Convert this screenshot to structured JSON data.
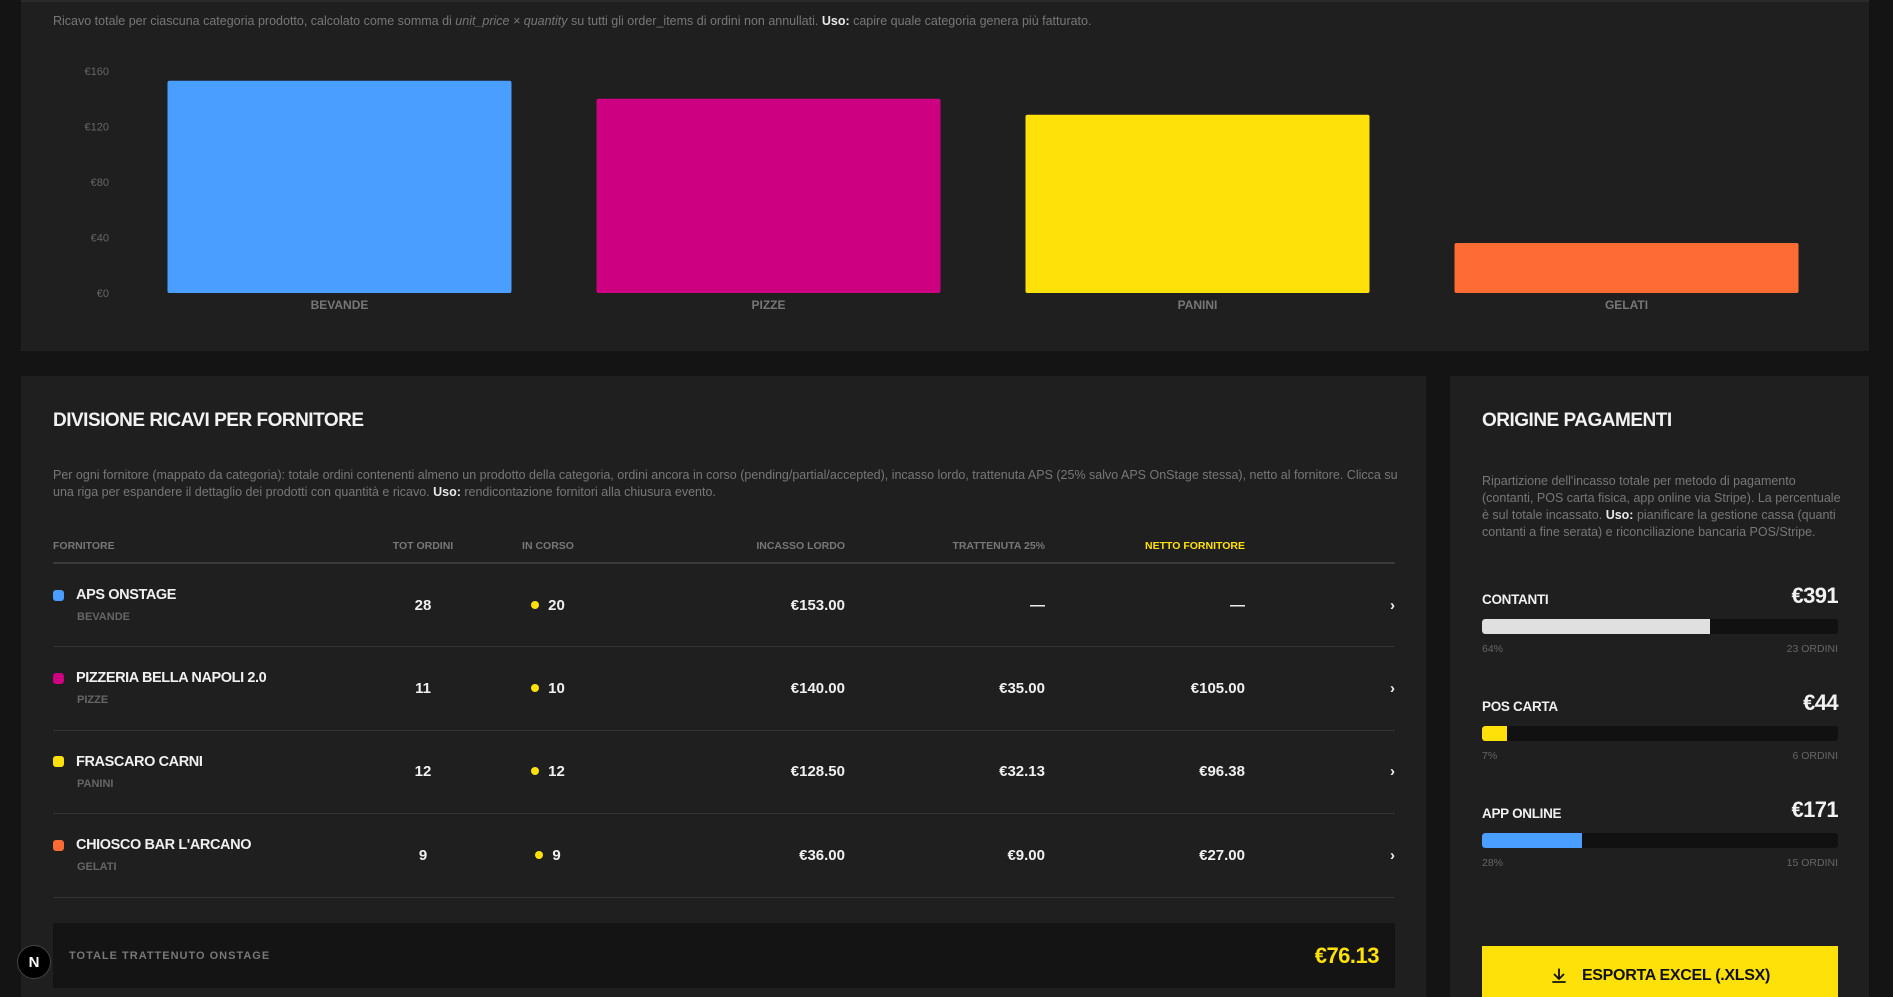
{
  "chart": {
    "description_prefix": "Ricavo totale per ciascuna categoria prodotto, calcolato come somma di ",
    "description_formula": "unit_price × quantity",
    "description_middle": " su tutti gli order_items di ordini non annullati. ",
    "description_use_label": "Uso:",
    "description_use": " capire quale categoria genera più fatturato."
  },
  "chart_data": {
    "type": "bar",
    "categories": [
      "BEVANDE",
      "PIZZE",
      "PANINI",
      "GELATI"
    ],
    "values": [
      153,
      140,
      128.5,
      36
    ],
    "colors": [
      "#4a9eff",
      "#cc0080",
      "#ffe10a",
      "#ff6b35"
    ],
    "ylim": [
      0,
      160
    ],
    "yticks": [
      0,
      40,
      80,
      120,
      160
    ],
    "ytick_labels": [
      "€0",
      "€40",
      "€80",
      "€120",
      "€160"
    ],
    "title": "",
    "xlabel": "",
    "ylabel": "",
    "grid": false,
    "legend": "none"
  },
  "suppliers": {
    "title": "DIVISIONE RICAVI PER FORNITORE",
    "description": "Per ogni fornitore (mappato da categoria): totale ordini contenenti almeno un prodotto della categoria, ordini ancora in corso (pending/partial/accepted), incasso lordo, trattenuta APS (25% salvo APS OnStage stessa), netto al fornitore. Clicca su una riga per espandere il dettaglio dei prodotti con quantità e ricavo. ",
    "description_use_label": "Uso:",
    "description_use": " rendicontazione fornitori alla chiusura evento.",
    "columns": {
      "supplier": "FORNITORE",
      "orders": "TOT ORDINI",
      "pending": "IN CORSO",
      "gross": "INCASSO LORDO",
      "fee": "TRATTENUTA 25%",
      "net": "NETTO FORNITORE"
    },
    "rows": [
      {
        "name": "APS ONSTAGE",
        "category": "BEVANDE",
        "color": "#4a9eff",
        "orders": "28",
        "pending": "20",
        "gross": "€153.00",
        "fee": "—",
        "net": "—"
      },
      {
        "name": "PIZZERIA BELLA NAPOLI 2.0",
        "category": "PIZZE",
        "color": "#cc0080",
        "orders": "11",
        "pending": "10",
        "gross": "€140.00",
        "fee": "€35.00",
        "net": "€105.00"
      },
      {
        "name": "FRASCARO CARNI",
        "category": "PANINI",
        "color": "#ffe10a",
        "orders": "12",
        "pending": "12",
        "gross": "€128.50",
        "fee": "€32.13",
        "net": "€96.38"
      },
      {
        "name": "CHIOSCO BAR L'ARCANO",
        "category": "GELATI",
        "color": "#ff6b35",
        "orders": "9",
        "pending": "9",
        "gross": "€36.00",
        "fee": "€9.00",
        "net": "€27.00"
      }
    ],
    "total_label": "TOTALE TRATTENUTO ONSTAGE",
    "total_value": "€76.13"
  },
  "payments": {
    "title": "ORIGINE PAGAMENTI",
    "description": "Ripartizione dell'incasso totale per metodo di pagamento (contanti, POS carta fisica, app online via Stripe). La percentuale è sul totale incassato. ",
    "description_use_label": "Uso:",
    "description_use": " pianificare la gestione cassa (quanti contanti a fine serata) e riconciliazione bancaria POS/Stripe.",
    "items": [
      {
        "label": "CONTANTI",
        "amount": "€391",
        "percent_label": "64%",
        "percent": 64,
        "orders": "23 ORDINI",
        "color": "#e0e0e0"
      },
      {
        "label": "POS CARTA",
        "amount": "€44",
        "percent_label": "7%",
        "percent": 7,
        "orders": "6 ORDINI",
        "color": "#ffe10a"
      },
      {
        "label": "APP ONLINE",
        "amount": "€171",
        "percent_label": "28%",
        "percent": 28,
        "orders": "15 ORDINI",
        "color": "#4a9eff"
      }
    ],
    "export_label": "ESPORTA EXCEL (.XLSX)"
  },
  "badge": {
    "letter": "N"
  }
}
